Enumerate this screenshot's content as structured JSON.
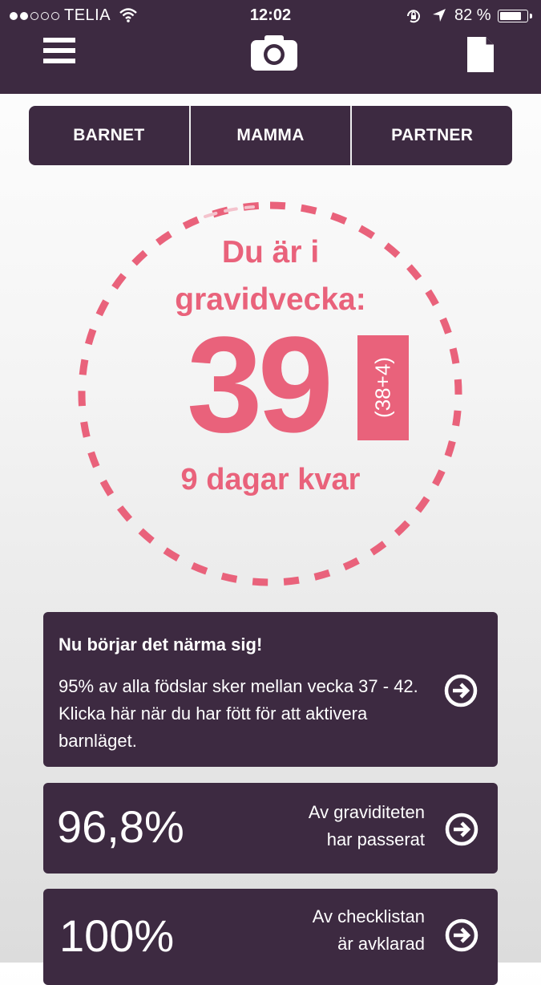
{
  "status": {
    "carrier": "TELIA",
    "time": "12:02",
    "battery": "82 %",
    "battery_level": 0.82
  },
  "header": {
    "menu_icon": "menu-icon",
    "camera_icon": "camera-icon",
    "document_icon": "document-icon"
  },
  "tabs": [
    {
      "label": "BARNET"
    },
    {
      "label": "MAMMA"
    },
    {
      "label": "PARTNER"
    }
  ],
  "progress": {
    "line1": "Du är i",
    "line2": "gravidvecka:",
    "week": "39",
    "exact": "(38+4)",
    "remaining": "9 dagar kvar",
    "accent": "#e9627b"
  },
  "cards": {
    "info": {
      "title": "Nu börjar det närma sig!",
      "body": "95% av alla födslar sker mellan vecka 37 - 42. Klicka här när du har fött för att aktivera barnläget."
    },
    "pregnancy": {
      "value": "96,8%",
      "label_line1": "Av graviditeten",
      "label_line2": "har passerat"
    },
    "checklist": {
      "value": "100%",
      "label_line1": "Av checklistan",
      "label_line2": "är avklarad"
    }
  },
  "colors": {
    "primary": "#3d2a41",
    "accent": "#e9627b"
  }
}
